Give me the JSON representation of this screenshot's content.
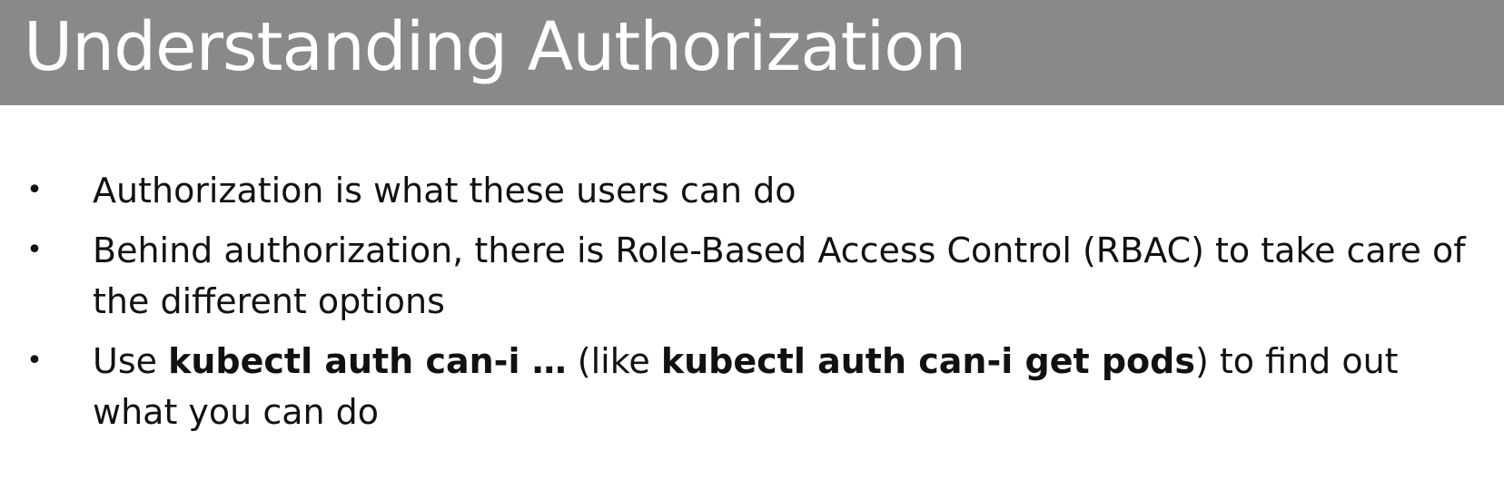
{
  "slide": {
    "title": "Understanding Authorization",
    "bullets": [
      {
        "segments": [
          {
            "text": "Authorization is what these users can do",
            "bold": false
          }
        ]
      },
      {
        "segments": [
          {
            "text": "Behind authorization, there is Role-Based Access Control (RBAC) to take care of the different options",
            "bold": false
          }
        ]
      },
      {
        "segments": [
          {
            "text": "Use ",
            "bold": false
          },
          {
            "text": "kubectl auth can-i …",
            "bold": true
          },
          {
            "text": " (like ",
            "bold": false
          },
          {
            "text": "kubectl auth can-i get pods",
            "bold": true
          },
          {
            "text": ") to find out what you can do",
            "bold": false
          }
        ]
      }
    ],
    "bullet_symbol": "•"
  },
  "colors": {
    "title_bar": "#898989",
    "title_text": "#ffffff",
    "body_text": "#111111",
    "background": "#ffffff"
  }
}
